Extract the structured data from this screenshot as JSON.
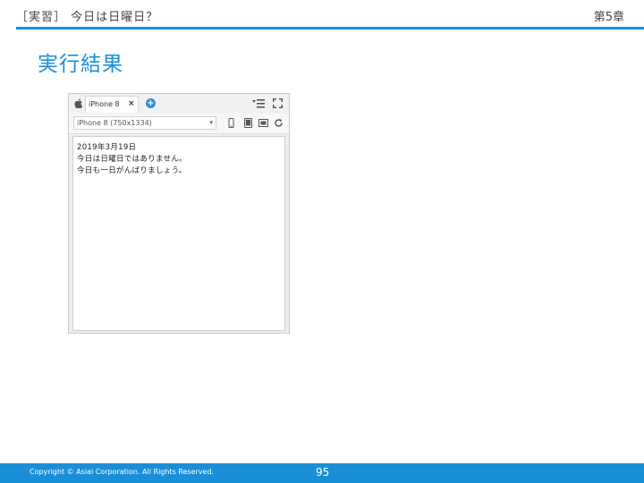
{
  "header": {
    "title": "［実習］ 今日は日曜日？",
    "chapter": "第5章"
  },
  "slide": {
    "heading": "実行結果"
  },
  "simulator": {
    "tab": {
      "label": "iPhone 8",
      "close": "×"
    },
    "add_tab": "+",
    "device_select": {
      "value": "iPhone 8 (750x1334)",
      "arrow": "▾"
    },
    "output_lines": [
      "2019年3月19日",
      "今日は日曜日ではありません。",
      "今日も一日がんばりましょう。"
    ],
    "icons": [
      "apple-icon",
      "menu-icon",
      "expand-icon",
      "phone-icon",
      "tablet-icon",
      "screenshot-icon",
      "refresh-icon"
    ]
  },
  "footer": {
    "copyright": "Copyright © Asial Corporation. All Rights Reserved.",
    "page_number": "95"
  },
  "colors": {
    "accent": "#1a8fd8",
    "add_button": "#2f8fe0"
  }
}
